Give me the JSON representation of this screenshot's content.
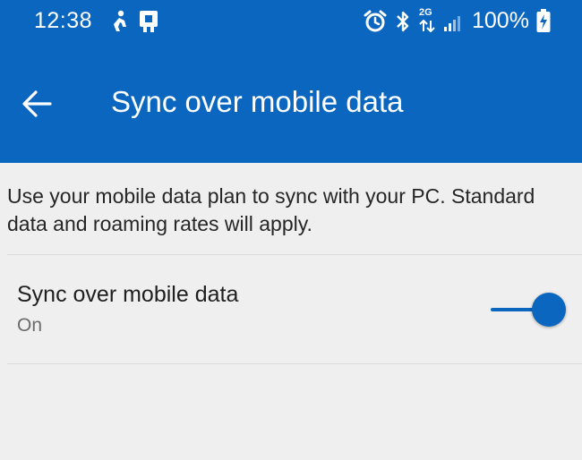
{
  "status_bar": {
    "time": "12:38",
    "battery_percent": "100%",
    "network_label": "2G",
    "icons": [
      "steps-icon",
      "notification-app-icon",
      "alarm-icon",
      "bluetooth-icon",
      "data-transfer-icon",
      "signal-icon",
      "battery-charging-icon"
    ]
  },
  "toolbar": {
    "back_icon": "arrow-left-icon",
    "title": "Sync over mobile data"
  },
  "content": {
    "description": "Use your mobile data plan to sync with your PC. Standard data and roaming rates will apply.",
    "setting": {
      "title": "Sync over mobile data",
      "status": "On",
      "enabled": true
    }
  },
  "colors": {
    "accent": "#0a66bf",
    "background": "#efefef",
    "text_primary": "#1f1f1f",
    "text_secondary": "#6b6b6b"
  }
}
